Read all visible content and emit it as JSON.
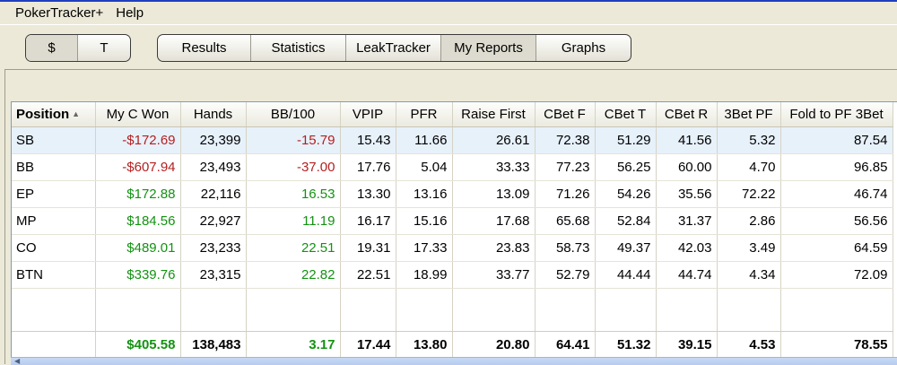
{
  "menu": {
    "items": [
      "PokerTracker+",
      "Help"
    ]
  },
  "toolbar": {
    "currency_buttons": [
      "$",
      "T"
    ],
    "nav_buttons": [
      "Results",
      "Statistics",
      "LeakTracker",
      "My Reports",
      "Graphs"
    ]
  },
  "table": {
    "columns": [
      "Position",
      "My C Won",
      "Hands",
      "BB/100",
      "VPIP",
      "PFR",
      "Raise First",
      "CBet F",
      "CBet T",
      "CBet R",
      "3Bet PF",
      "Fold to PF 3Bet"
    ],
    "rows": [
      [
        "SB",
        "-$172.69",
        "23,399",
        "-15.79",
        "15.43",
        "11.66",
        "26.61",
        "72.38",
        "51.29",
        "41.56",
        "5.32",
        "87.54"
      ],
      [
        "BB",
        "-$607.94",
        "23,493",
        "-37.00",
        "17.76",
        "5.04",
        "33.33",
        "77.23",
        "56.25",
        "60.00",
        "4.70",
        "96.85"
      ],
      [
        "EP",
        "$172.88",
        "22,116",
        "16.53",
        "13.30",
        "13.16",
        "13.09",
        "71.26",
        "54.26",
        "35.56",
        "72.22",
        "46.74"
      ],
      [
        "MP",
        "$184.56",
        "22,927",
        "11.19",
        "16.17",
        "15.16",
        "17.68",
        "65.68",
        "52.84",
        "31.37",
        "2.86",
        "56.56"
      ],
      [
        "CO",
        "$489.01",
        "23,233",
        "22.51",
        "19.31",
        "17.33",
        "23.83",
        "58.73",
        "49.37",
        "42.03",
        "3.49",
        "64.59"
      ],
      [
        "BTN",
        "$339.76",
        "23,315",
        "22.82",
        "22.51",
        "18.99",
        "33.77",
        "52.79",
        "44.44",
        "44.74",
        "4.34",
        "72.09"
      ]
    ],
    "totals": [
      "",
      "$405.58",
      "138,483",
      "3.17",
      "17.44",
      "13.80",
      "20.80",
      "64.41",
      "51.32",
      "39.15",
      "4.53",
      "78.55"
    ]
  },
  "colors": {
    "negative": "#b51f1f",
    "positive": "#139212",
    "selected_row": "#e7f1fa"
  }
}
